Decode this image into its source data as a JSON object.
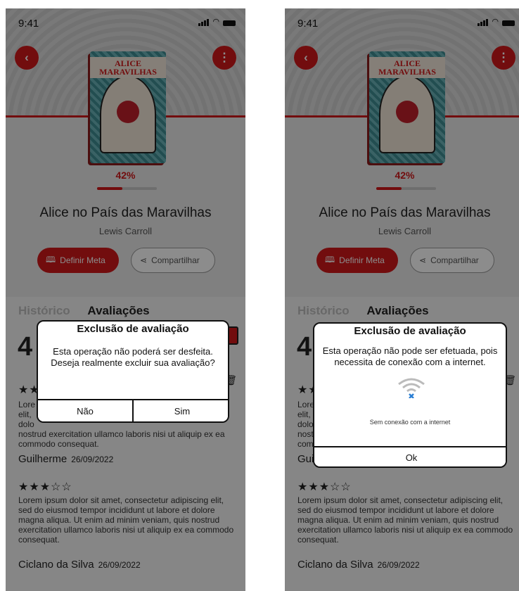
{
  "status": {
    "time": "9:41"
  },
  "book": {
    "cover_title": "ALICE\nMARAVILHAS",
    "progress_text": "42%",
    "progress_value": 0.42,
    "title": "Alice no País das Maravilhas",
    "author": "Lewis Carroll"
  },
  "actions": {
    "meta_label": "Definir Meta",
    "share_label": "Compartilhar"
  },
  "tabs": {
    "history": "Histórico",
    "reviews": "Avaliações"
  },
  "rating": {
    "big": "4"
  },
  "reviews": [
    {
      "stars": "★★",
      "text_visible": "Lore\nelit,\ndolo",
      "text_tail": "nostrud exercitation ullamco laboris nisi ut aliquip ex ea commodo consequat.",
      "author": "Guilherme",
      "date": "26/09/2022"
    },
    {
      "stars": "★★★☆☆",
      "text": "Lorem ipsum dolor sit amet, consectetur adipiscing elit, sed do eiusmod tempor incididunt ut labore et dolore magna aliqua. Ut enim ad minim veniam, quis nostrud exercitation ullamco laboris nisi ut aliquip ex ea commodo consequat.",
      "author": "Ciclano da Silva",
      "date": "26/09/2022"
    }
  ],
  "dialog_confirm": {
    "title": "Exclusão de avaliação",
    "message": "Esta operação não poderá ser desfeita. Deseja realmente excluir sua avaliação?",
    "no_label": "Não",
    "yes_label": "Sim"
  },
  "dialog_offline": {
    "title": "Exclusão de avaliação",
    "message": "Esta operação não pode ser efetuada, pois necessita de conexão com a internet.",
    "caption": "Sem conexão com a internet",
    "ok_label": "Ok"
  },
  "colors": {
    "accent": "#d0191a",
    "overlay": "#000000"
  },
  "icons": [
    "back-arrow-icon",
    "more-vertical-icon",
    "book-open-icon",
    "share-icon",
    "trash-icon",
    "wifi-off-icon"
  ]
}
